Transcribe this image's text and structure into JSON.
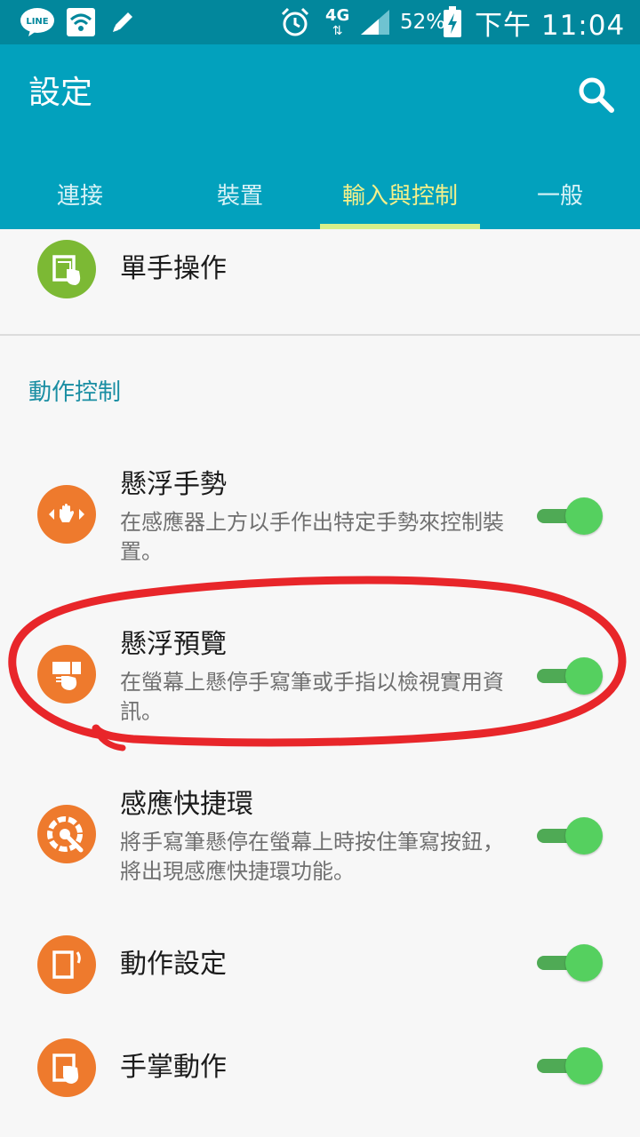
{
  "status_bar": {
    "line_label": "LINE",
    "network": "4G",
    "battery": "52%",
    "time": "下午 11:04",
    "icons": [
      "line-icon",
      "wifi-icon",
      "edit-icon",
      "alarm-icon",
      "signal-icon",
      "battery-charging-icon"
    ]
  },
  "header": {
    "title": "設定",
    "search_icon": "search-icon"
  },
  "tabs": [
    {
      "label": "連接",
      "active": false
    },
    {
      "label": "裝置",
      "active": false
    },
    {
      "label": "輸入與控制",
      "active": true
    },
    {
      "label": "一般",
      "active": false
    }
  ],
  "one_handed": {
    "title": "單手操作",
    "icon": "one-hand-icon",
    "color": "#7cb934"
  },
  "section": {
    "label": "動作控制"
  },
  "items": [
    {
      "title": "懸浮手勢",
      "desc": "在感應器上方以手作出特定手勢來控制裝置。",
      "enabled": true,
      "icon": "air-gesture-icon"
    },
    {
      "title": "懸浮預覽",
      "desc": "在螢幕上懸停手寫筆或手指以檢視實用資訊。",
      "enabled": true,
      "icon": "air-view-icon"
    },
    {
      "title": "感應快捷環",
      "desc": "將手寫筆懸停在螢幕上時按住筆寫按鈕，將出現感應快捷環功能。",
      "enabled": true,
      "icon": "air-command-icon"
    },
    {
      "title": "動作設定",
      "desc": "",
      "enabled": true,
      "icon": "motion-icon"
    },
    {
      "title": "手掌動作",
      "desc": "",
      "enabled": true,
      "icon": "palm-motion-icon"
    }
  ],
  "colors": {
    "status_bar": "#02879c",
    "header": "#02a1bd",
    "tab_active": "#f4f08a",
    "icon_orange": "#ee7a2d",
    "toggle_on": "#55d05f",
    "section_text": "#1a8ea3",
    "annotation": "#e8262a"
  }
}
